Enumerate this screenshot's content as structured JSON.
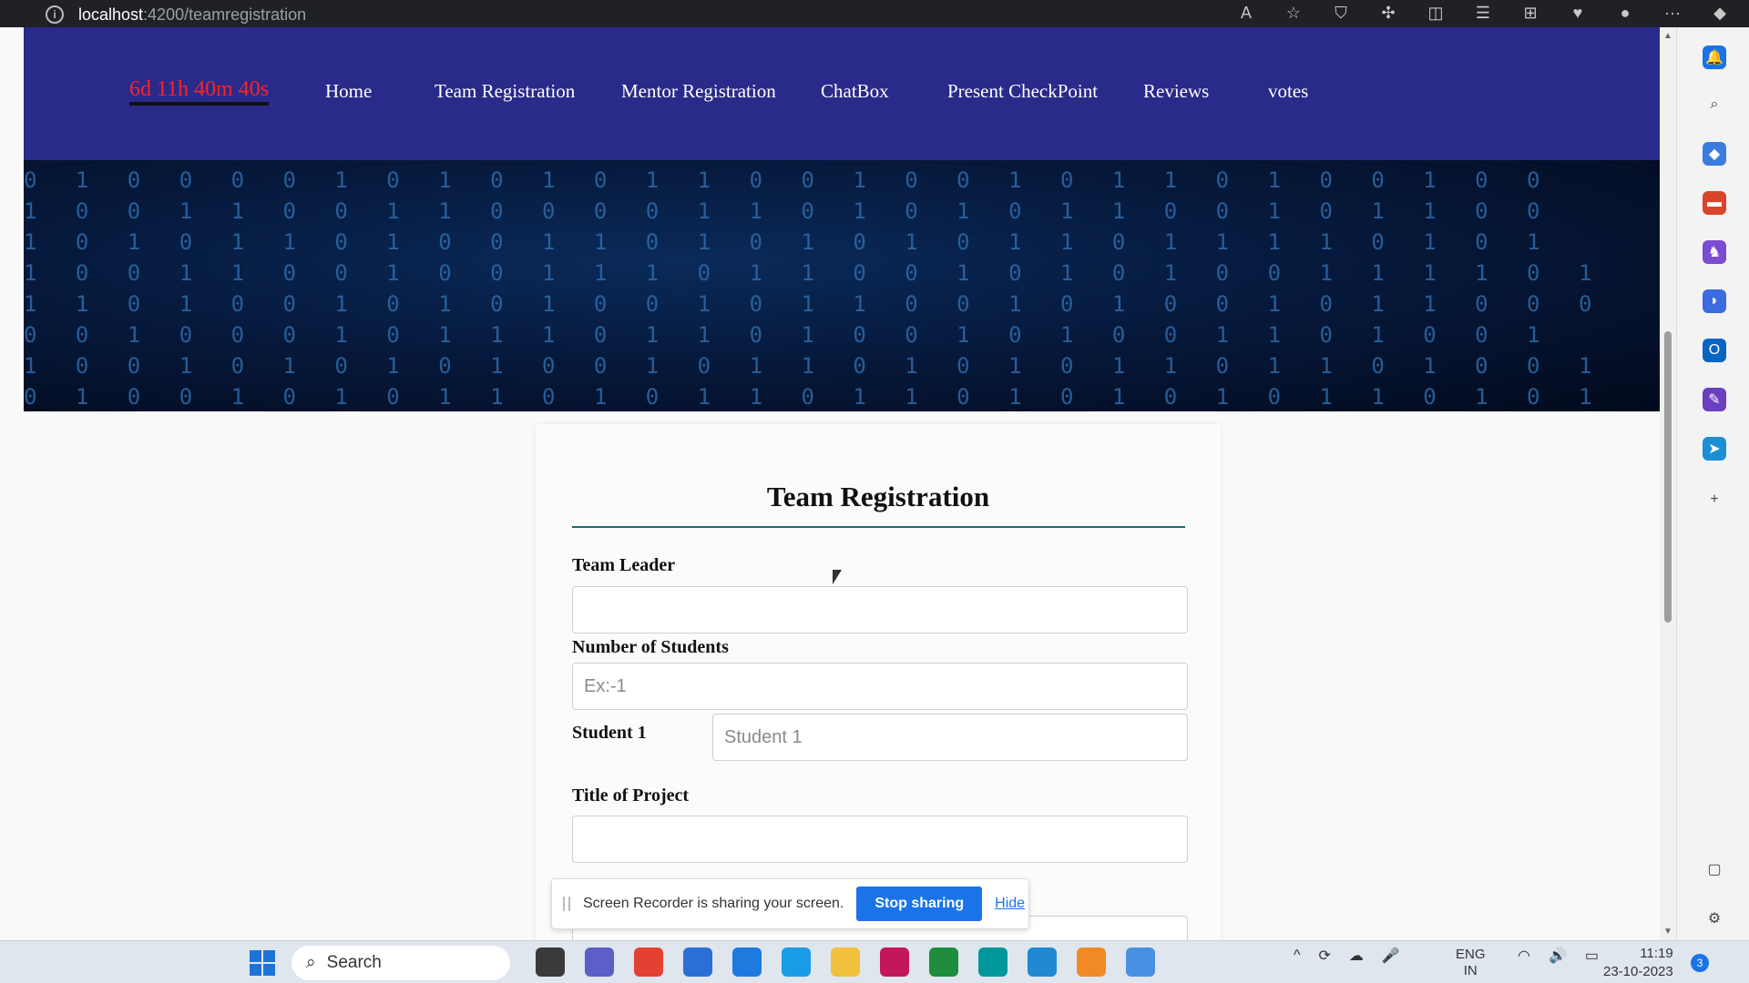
{
  "browser": {
    "url_host": "localhost",
    "url_path": ":4200/teamregistration"
  },
  "nav": {
    "timer": "6d 11h 40m 40s",
    "items": [
      "Home",
      "Team Registration",
      "Mentor Registration",
      "ChatBox",
      "Present CheckPoint",
      "Reviews",
      "votes"
    ]
  },
  "banner": {
    "rows": [
      "0 1 0   0 0 0 1 0 1   0 1   0 1 1 0   0 1 0 0 1 0   1 1   0 1 0 0   1   0 0",
      "1 0   0 1   1 0 0 1   1 0 0 0   0 1 1 0 1 0   1 0 1   1 0   0 1 0 1 1 0 0",
      "1 0 1 0   1 1 0   1 0   0 1 1 0 1 0 1   0 1 0 1   1 0   1 1 1 1 0 1 0 1",
      "1   0   0 1   1 0 0 1 0 0 1 1 1 0 1   1 0 0 1   0 1 0 1 0 0 1 1 1 1 0 1",
      "1 1 0 1 0   0 1 0 1   0 1 0 0 1 0   1 1   0 0 1 0 1 0 0 1   0 1 1 0 0 0",
      "0   0 1 0   0 0 1   0 1   1 1 0 1 1   0 1 0 0 1 0 1 0 0 1 1 0 1   0 0 1",
      "1 0 0 1 0 1   0 1 0 1 0   0 1 0 1   1 0 1 0   1 0 1 1 0 1 1 0   1 0 0 1",
      "0 1 0 0   1 0 1   0 1 1   0 1 0 1 1 0 1 1   0 1 0 1 0 1 0 1 1 0 1 0 1"
    ]
  },
  "form": {
    "title": "Team Registration",
    "team_leader_label": "Team Leader",
    "team_leader_value": "",
    "num_students_label": "Number of Students",
    "num_students_placeholder": "Ex:-1",
    "student1_label": "Student 1",
    "student1_placeholder": "Student 1",
    "project_title_label": "Title of Project",
    "project_title_value": ""
  },
  "sharebar": {
    "message": "Screen Recorder is sharing your screen.",
    "stop_label": "Stop sharing",
    "hide_label": "Hide"
  },
  "taskbar": {
    "search_label": "Search",
    "lang_line1": "ENG",
    "lang_line2": "IN",
    "time": "11:19",
    "date": "23-10-2023",
    "notifications": "3"
  },
  "colors": {
    "nav_bg": "#2a2a8a",
    "timer": "#ff2222",
    "accent_rule": "#1e6b6b",
    "stop_button": "#1a73e8"
  }
}
